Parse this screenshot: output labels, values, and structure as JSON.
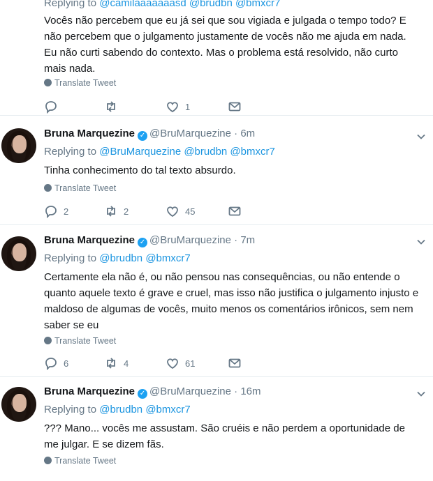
{
  "translate_label": "Translate Tweet",
  "tweets": [
    {
      "replying_prefix": "Replying to",
      "replying_to": "@camilaaaaaaasd @brudbn @bmxcr7",
      "text": "Vocês não percebem que eu já sei que sou vigiada e julgada o tempo todo? E não percebem que o julgamento justamente de vocês não me ajuda em nada. Eu não curti sabendo do contexto. Mas o problema está resolvido, não curto mais nada.",
      "replies": "",
      "retweets": "",
      "likes": "1"
    },
    {
      "name": "Bruna Marquezine",
      "handle": "@BruMarquezine",
      "time": "6m",
      "replying_prefix": "Replying to",
      "replying_to": "@BruMarquezine @brudbn @bmxcr7",
      "text": "Tinha conhecimento do tal texto absurdo.",
      "replies": "2",
      "retweets": "2",
      "likes": "45"
    },
    {
      "name": "Bruna Marquezine",
      "handle": "@BruMarquezine",
      "time": "7m",
      "replying_prefix": "Replying to",
      "replying_to": "@brudbn @bmxcr7",
      "text": "Certamente ela não é, ou não pensou nas consequências, ou não entende o quanto aquele texto é grave e cruel, mas isso não justifica o julgamento injusto e maldoso de algumas de vocês, muito menos os comentários irônicos, sem nem saber se eu",
      "replies": "6",
      "retweets": "4",
      "likes": "61"
    },
    {
      "name": "Bruna Marquezine",
      "handle": "@BruMarquezine",
      "time": "16m",
      "replying_prefix": "Replying to",
      "replying_to": "@brudbn @bmxcr7",
      "text": "??? Mano... vocês me assustam. São cruéis e não perdem a oportunidade de me julgar. E se dizem fãs.",
      "replies": "",
      "retweets": "",
      "likes": ""
    }
  ]
}
